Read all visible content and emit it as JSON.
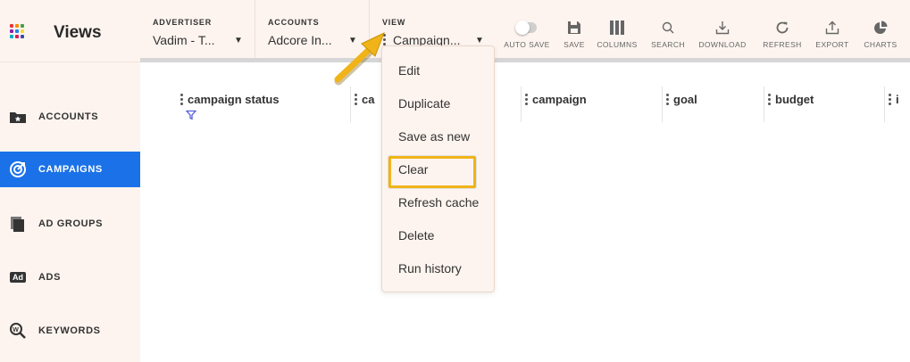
{
  "app": {
    "title": "Views",
    "logo_colors": [
      "#e53935",
      "#fb8c00",
      "#43a047",
      "#8e24aa",
      "#1e88e5",
      "#fdd835",
      "#00acc1",
      "#d81b60",
      "#3949ab"
    ]
  },
  "sidebar": {
    "items": [
      {
        "label": "ACCOUNTS",
        "icon": "folder-star-icon"
      },
      {
        "label": "CAMPAIGNS",
        "icon": "target-icon",
        "active": true
      },
      {
        "label": "AD GROUPS",
        "icon": "stacked-pages-icon"
      },
      {
        "label": "ADS",
        "icon": "ad-badge-icon",
        "badge": "Ad"
      },
      {
        "label": "KEYWORDS",
        "icon": "keyword-search-icon"
      }
    ]
  },
  "topbar": {
    "advertiser": {
      "label": "ADVERTISER",
      "value": "Vadim - T..."
    },
    "accounts": {
      "label": "ACCOUNTS",
      "value": "Adcore In..."
    },
    "view": {
      "label": "VIEW",
      "value": "Campaign..."
    }
  },
  "tools": [
    {
      "label": "AUTO SAVE",
      "icon": "toggle-icon"
    },
    {
      "label": "SAVE",
      "icon": "floppy-disk-icon"
    },
    {
      "label": "COLUMNS",
      "icon": "columns-icon"
    },
    {
      "label": "SEARCH",
      "icon": "search-icon"
    },
    {
      "label": "DOWNLOAD",
      "icon": "download-icon"
    },
    {
      "label": "REFRESH",
      "icon": "refresh-icon"
    },
    {
      "label": "EXPORT",
      "icon": "export-icon"
    },
    {
      "label": "CHARTS",
      "icon": "pie-chart-icon"
    }
  ],
  "table": {
    "columns": [
      "campaign status",
      "ca",
      "campaign",
      "goal",
      "budget",
      "i"
    ]
  },
  "view_menu": {
    "items": [
      "Edit",
      "Duplicate",
      "Save as new",
      "Clear",
      "Refresh cache",
      "Delete",
      "Run history"
    ],
    "highlighted": "Clear"
  },
  "colors": {
    "accent": "#1b72e8",
    "highlight": "#f0b419",
    "panel_bg": "#fdf4ef"
  }
}
